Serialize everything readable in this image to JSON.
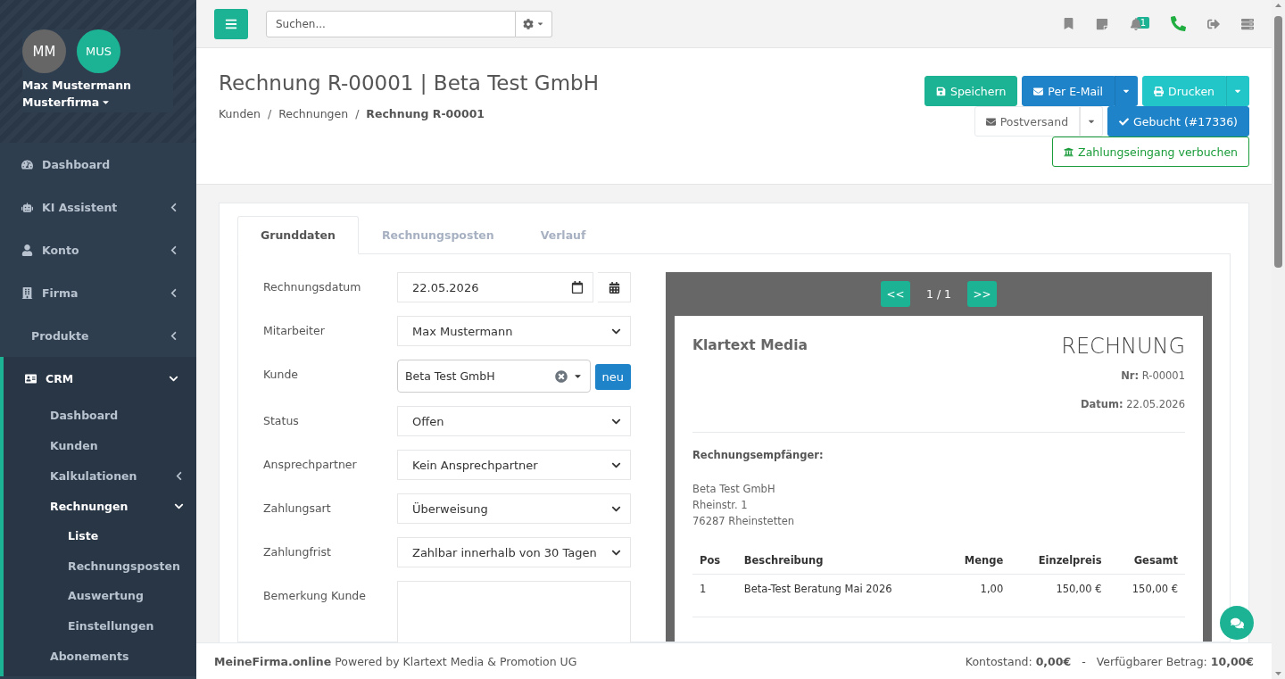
{
  "sidebar": {
    "user": {
      "avatars": [
        {
          "initials": "MM",
          "kind": "gray"
        },
        {
          "initials": "MUS",
          "kind": "teal"
        }
      ],
      "name": "Max Mustermann",
      "company": "Musterfirma"
    },
    "menu": [
      {
        "label": "Dashboard",
        "selected": false
      },
      {
        "label": "KI Assistent",
        "selected": false,
        "expanded": false
      },
      {
        "label": "Konto",
        "selected": false,
        "expanded": false
      },
      {
        "label": "Firma",
        "selected": false,
        "expanded": false
      },
      {
        "label": "Produkte",
        "selected": false,
        "expanded": false
      },
      {
        "label": "CRM",
        "selected": true,
        "expanded": true,
        "children": [
          {
            "label": "Dashboard",
            "selected": false
          },
          {
            "label": "Kunden",
            "selected": false
          },
          {
            "label": "Kalkulationen",
            "selected": false,
            "expanded": false
          },
          {
            "label": "Rechnungen",
            "selected": true,
            "expanded": true,
            "children": [
              {
                "label": "Liste",
                "selected": true
              },
              {
                "label": "Rechnungsposten",
                "selected": false
              },
              {
                "label": "Auswertung",
                "selected": false
              },
              {
                "label": "Einstellungen",
                "selected": false
              }
            ]
          },
          {
            "label": "Abonements",
            "selected": false
          }
        ]
      }
    ]
  },
  "topbar": {
    "search": {
      "placeholder": "Suchen..."
    },
    "notification_count": "1"
  },
  "header": {
    "title": "Rechnung R-00001 | Beta Test GmbH",
    "breadcrumb_separator": "/",
    "breadcrumb": [
      {
        "label": "Kunden",
        "current": false
      },
      {
        "label": "Rechnungen",
        "current": false
      },
      {
        "label": "Rechnung R-00001",
        "current": true
      }
    ],
    "action_rows": [
      [
        {
          "label": "Speichern",
          "kind": "success",
          "split": false
        },
        {
          "label": "Per E-Mail",
          "kind": "primary",
          "split": true
        },
        {
          "label": "Drucken",
          "kind": "info",
          "split": true
        }
      ],
      [
        {
          "label": "Postversand",
          "kind": "default",
          "split": true
        },
        {
          "label": "Gebucht (#17336)",
          "kind": "primary",
          "split": false
        }
      ],
      [
        {
          "label": "Zahlungseingang verbuchen",
          "kind": "outline",
          "split": false
        }
      ]
    ]
  },
  "tabs": [
    {
      "label": "Grunddaten",
      "selected": true
    },
    {
      "label": "Rechnungsposten",
      "selected": false
    },
    {
      "label": "Verlauf",
      "selected": false
    }
  ],
  "form": [
    {
      "label": "Rechnungsdatum",
      "kind": "date",
      "value": "22.05.2026"
    },
    {
      "label": "Mitarbeiter",
      "kind": "select",
      "value": "Max Mustermann"
    },
    {
      "label": "Kunde",
      "kind": "combo",
      "value": "Beta Test GmbH",
      "button": "neu"
    },
    {
      "label": "Status",
      "kind": "select",
      "value": "Offen"
    },
    {
      "label": "Ansprechpartner",
      "kind": "select",
      "value": "Kein Ansprechpartner"
    },
    {
      "label": "Zahlungsart",
      "kind": "select",
      "value": "Überweisung"
    },
    {
      "label": "Zahlungfrist",
      "kind": "select",
      "value": "Zahlbar innerhalb von 30 Tagen"
    },
    {
      "label": "Bemerkung Kunde",
      "kind": "textarea"
    }
  ],
  "preview": {
    "prev": "<<",
    "page": "1 / 1",
    "next": ">>",
    "document": {
      "company": "Klartext Media",
      "title": "RECHNUNG",
      "meta": [
        "**Nr:** R-00001",
        "**Datum:** 22.05.2026"
      ],
      "recipient_heading": "Rechnungsempfänger:",
      "recipient": [
        "Beta Test GmbH",
        "Rheinstr. 1",
        "76287 Rheinstetten"
      ],
      "columns": [
        "Pos",
        "Beschreibung",
        "Menge",
        "Einzelpreis",
        "Gesamt"
      ],
      "rows": [
        [
          "1",
          "Beta-Test Beratung Mai 2026",
          "1,00",
          "150,00 €",
          "150,00 €"
        ]
      ]
    }
  },
  "footer": {
    "left": "**MeineFirma.online** Powered by Klartext Media & Promotion UG",
    "balance": "Kontostand: **0,00€**",
    "separator": "-",
    "available": "Verfügbarer Betrag: **10,00€**"
  }
}
